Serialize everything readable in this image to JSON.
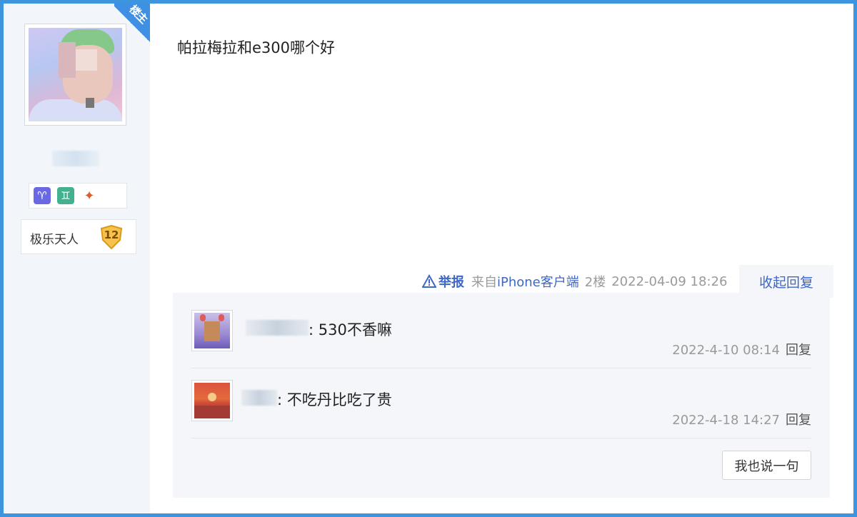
{
  "author": {
    "badge": "楼主",
    "level_title": "极乐天人",
    "level": "12",
    "icons": [
      "aries-icon",
      "gemini-icon",
      "game-icon"
    ]
  },
  "post": {
    "text": "帕拉梅拉和e300哪个好"
  },
  "meta": {
    "report": "举报",
    "client_prefix": "来自",
    "client_name": "iPhone客户端",
    "floor": "2楼",
    "time": "2022-04-09 18:26",
    "collapse": "收起回复"
  },
  "replies": [
    {
      "text": ": 530不香嘛",
      "time": "2022-4-10 08:14",
      "reply_label": "回复"
    },
    {
      "text": ": 不吃丹比吃了贵",
      "time": "2022-4-18 14:27",
      "reply_label": "回复"
    }
  ],
  "say_button": "我也说一句",
  "colors": {
    "frame": "#3d95e0",
    "link": "#3e67c6",
    "sidebar": "#f2f6fa",
    "reply_bg": "#f4f6f9"
  }
}
